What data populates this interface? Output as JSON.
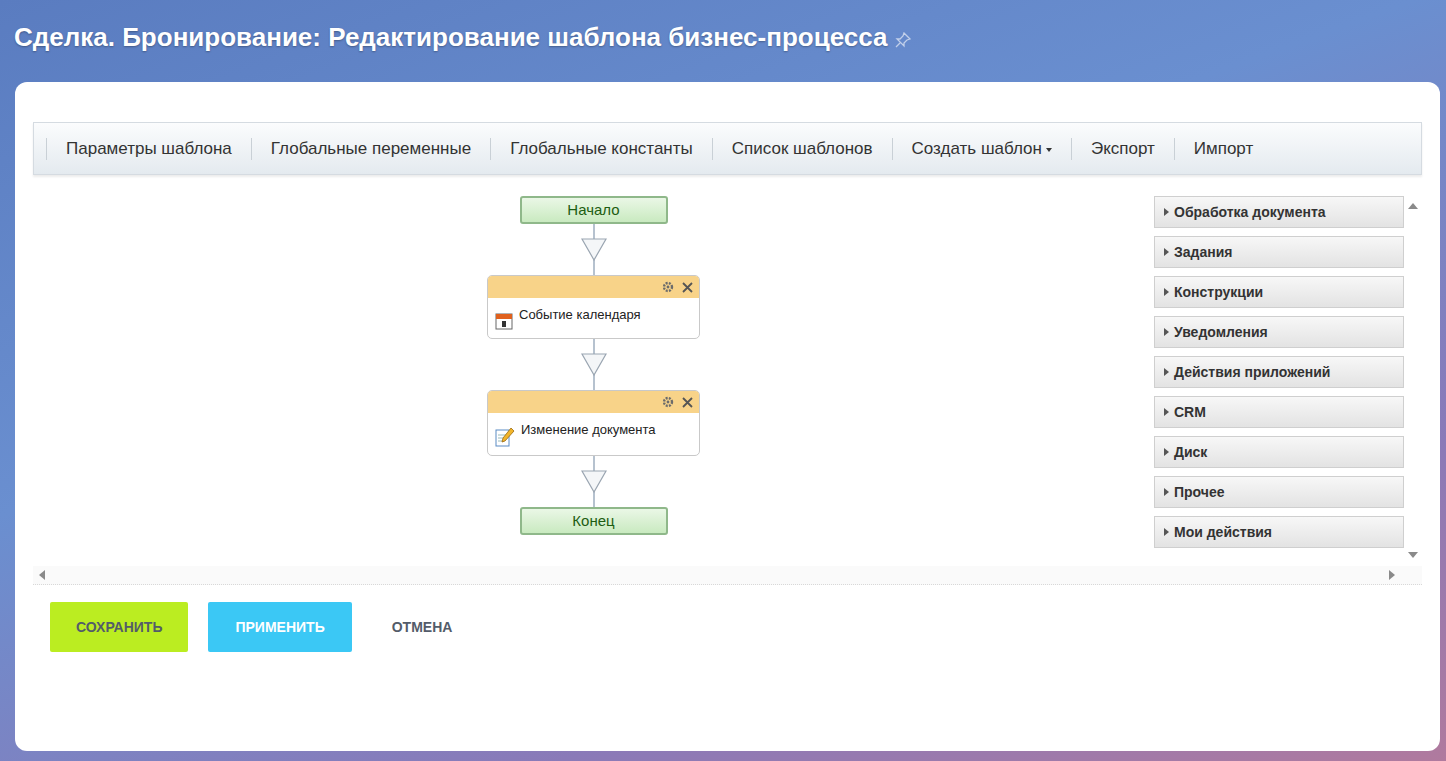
{
  "page": {
    "title": "Сделка. Бронирование: Редактирование шаблона бизнес-процесса",
    "pinned": false
  },
  "toolbar": [
    {
      "label": "Параметры шаблона",
      "has_dropdown": false
    },
    {
      "label": "Глобальные переменные",
      "has_dropdown": false
    },
    {
      "label": "Глобальные константы",
      "has_dropdown": false
    },
    {
      "label": "Список шаблонов",
      "has_dropdown": false
    },
    {
      "label": "Создать шаблон",
      "has_dropdown": true
    },
    {
      "label": "Экспорт",
      "has_dropdown": false
    },
    {
      "label": "Импорт",
      "has_dropdown": false
    }
  ],
  "diagram": {
    "start": "Начало",
    "activities": [
      {
        "label": "Событие календаря",
        "kind": "calendar"
      },
      {
        "label": "Изменение документа",
        "kind": "edit"
      }
    ],
    "end": "Конец"
  },
  "palette": [
    {
      "label": "Обработка документа",
      "expanded": false
    },
    {
      "label": "Задания",
      "expanded": false
    },
    {
      "label": "Конструкции",
      "expanded": false
    },
    {
      "label": "Уведомления",
      "expanded": false
    },
    {
      "label": "Действия приложений",
      "expanded": false
    },
    {
      "label": "CRM",
      "expanded": false
    },
    {
      "label": "Диск",
      "expanded": false
    },
    {
      "label": "Прочее",
      "expanded": false
    },
    {
      "label": "Мои действия",
      "expanded": false
    }
  ],
  "buttons": [
    {
      "label": "СОХРАНИТЬ",
      "kind": "save"
    },
    {
      "label": "ПРИМЕНИТЬ",
      "kind": "apply"
    },
    {
      "label": "ОТМЕНА",
      "kind": "cancel"
    }
  ]
}
